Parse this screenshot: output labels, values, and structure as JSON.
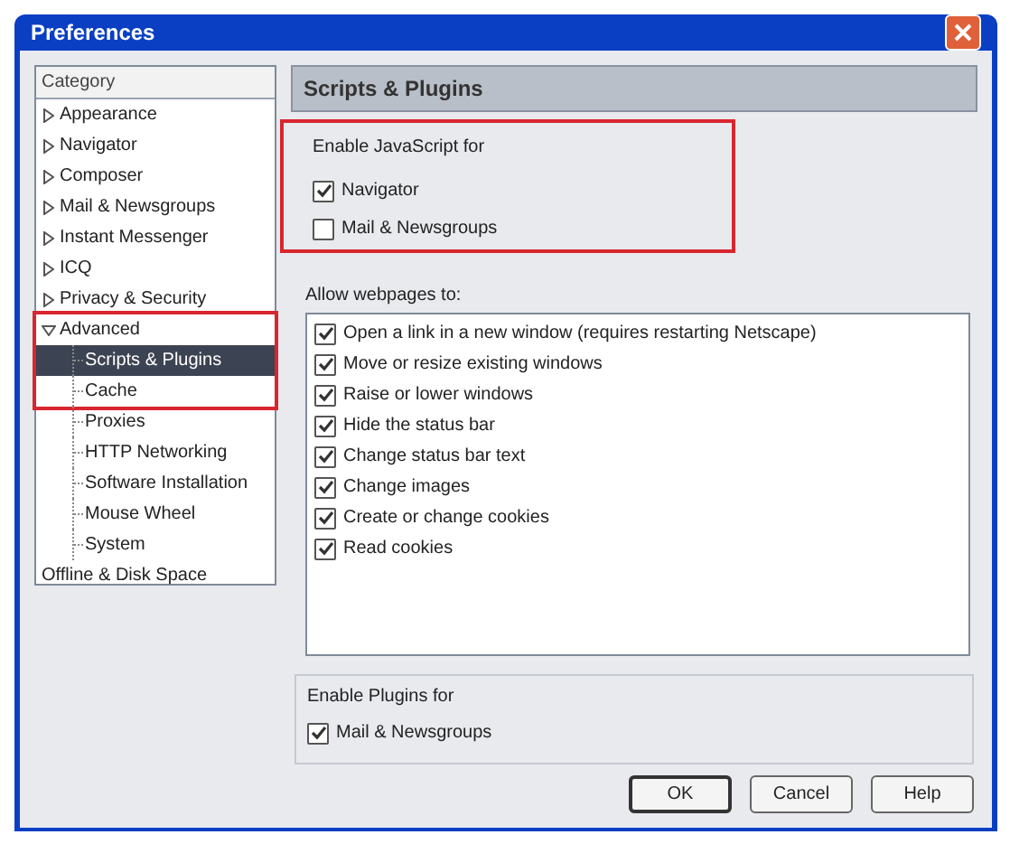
{
  "window": {
    "title": "Preferences"
  },
  "sidebar": {
    "header": "Category",
    "items": [
      {
        "label": "Appearance",
        "expanded": false,
        "selected": false,
        "highlighted": false
      },
      {
        "label": "Navigator",
        "expanded": false,
        "selected": false,
        "highlighted": false
      },
      {
        "label": "Composer",
        "expanded": false,
        "selected": false,
        "highlighted": false
      },
      {
        "label": "Mail & Newsgroups",
        "expanded": false,
        "selected": false,
        "highlighted": false
      },
      {
        "label": "Instant Messenger",
        "expanded": false,
        "selected": false,
        "highlighted": false
      },
      {
        "label": "ICQ",
        "expanded": false,
        "selected": false,
        "highlighted": false
      },
      {
        "label": "Privacy & Security",
        "expanded": false,
        "selected": false,
        "highlighted": false
      },
      {
        "label": "Advanced",
        "expanded": true,
        "selected": false,
        "highlighted": true,
        "children": [
          {
            "label": "Scripts & Plugins",
            "selected": true
          },
          {
            "label": "Cache",
            "selected": false
          },
          {
            "label": "Proxies",
            "selected": false
          },
          {
            "label": "HTTP Networking",
            "selected": false
          },
          {
            "label": "Software Installation",
            "selected": false
          },
          {
            "label": "Mouse Wheel",
            "selected": false
          },
          {
            "label": "System",
            "selected": false
          }
        ]
      },
      {
        "label": "Offline & Disk Space",
        "selected": false,
        "highlighted": false
      }
    ]
  },
  "panel": {
    "title": "Scripts & Plugins",
    "javascript": {
      "legend": "Enable JavaScript for",
      "highlighted": true,
      "options": [
        {
          "label": "Navigator",
          "checked": true
        },
        {
          "label": "Mail & Newsgroups",
          "checked": false
        }
      ]
    },
    "webpages": {
      "label": "Allow webpages to:",
      "options": [
        {
          "label": "Open a link in a new window (requires restarting Netscape)",
          "checked": true
        },
        {
          "label": "Move or resize existing windows",
          "checked": true
        },
        {
          "label": "Raise or lower windows",
          "checked": true
        },
        {
          "label": "Hide the status bar",
          "checked": true
        },
        {
          "label": "Change status bar text",
          "checked": true
        },
        {
          "label": "Change images",
          "checked": true
        },
        {
          "label": "Create or change cookies",
          "checked": true
        },
        {
          "label": "Read cookies",
          "checked": true
        }
      ]
    },
    "plugins": {
      "legend": "Enable Plugins for",
      "options": [
        {
          "label": "Mail & Newsgroups",
          "checked": true
        }
      ]
    }
  },
  "buttons": [
    {
      "label": "OK",
      "default": true
    },
    {
      "label": "Cancel",
      "default": false
    },
    {
      "label": "Help",
      "default": false
    }
  ]
}
